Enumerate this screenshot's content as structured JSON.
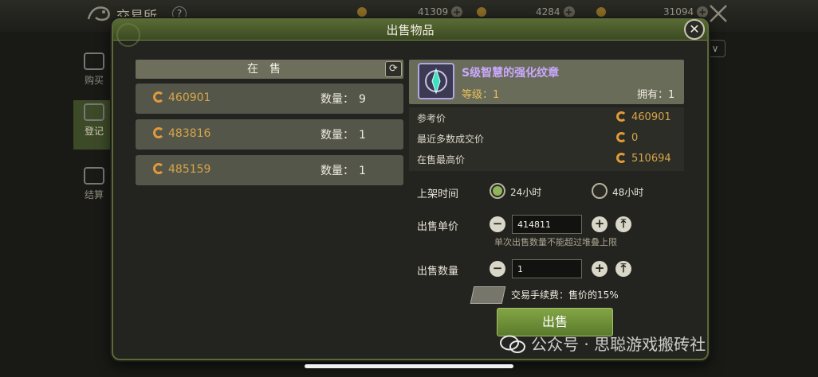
{
  "background": {
    "title": "交易所",
    "help": "?",
    "currencies": [
      {
        "amount": "41309",
        "plus": "+"
      },
      {
        "amount": "4284",
        "plus": "+"
      },
      {
        "amount": "31094",
        "plus": "+"
      }
    ],
    "side_nav": [
      {
        "label": "购买"
      },
      {
        "label": "登记"
      },
      {
        "label": "结算"
      }
    ],
    "dropdown_arrow": "∨"
  },
  "dialog": {
    "title": "出售物品",
    "close": "✕",
    "on_sale_header": "在售",
    "refresh": "⟳",
    "listings": [
      {
        "price": "460901",
        "qty_label": "数量：",
        "qty": "9"
      },
      {
        "price": "483816",
        "qty_label": "数量：",
        "qty": "1"
      },
      {
        "price": "485159",
        "qty_label": "数量：",
        "qty": "1"
      }
    ],
    "item": {
      "name": "S级智慧的强化纹章",
      "level": "等级：1",
      "owned": "拥有：1",
      "name_color": "#caa9ff"
    },
    "info": {
      "ref_price_label": "参考价",
      "ref_price": "460901",
      "recent_label": "最近多数成交价",
      "recent": "0",
      "highest_label": "在售最高价",
      "highest": "510694"
    },
    "form": {
      "duration_label": "上架时间",
      "option_24": "24小时",
      "option_48": "48小时",
      "selected_duration": "24小时",
      "unit_price_label": "出售单价",
      "unit_price": "414811",
      "minus": "−",
      "plus": "+",
      "max": "⤒",
      "hint": "单次出售数量不能超过堆叠上限",
      "quantity_label": "出售数量",
      "quantity": "1",
      "fee": "交易手续费：售价的15%",
      "sell_button": "出售"
    }
  },
  "watermark": "公众号 · 思聪游戏搬砖社",
  "colors": {
    "accent_green": "#5a7a2c",
    "gold": "#d6a547",
    "purple_item": "#b2a6e4"
  }
}
